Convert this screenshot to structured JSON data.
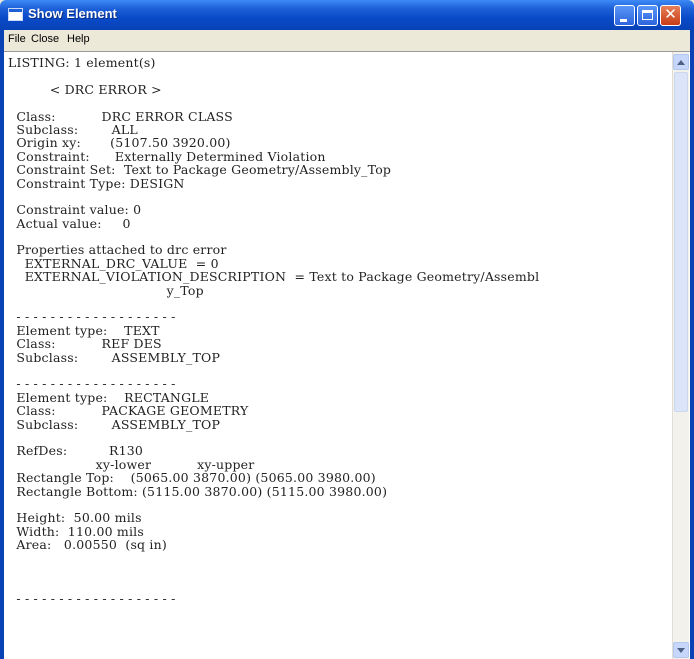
{
  "window": {
    "title": "Show Element",
    "buttons": {
      "close": "✕"
    }
  },
  "menu": {
    "file": "File",
    "close": "Close",
    "help": "Help"
  },
  "listing": [
    "LISTING: 1 element(s)",
    "",
    "          < DRC ERROR >",
    "",
    "  Class:           DRC ERROR CLASS",
    "  Subclass:        ALL",
    "  Origin xy:       (5107.50 3920.00)",
    "  Constraint:      Externally Determined Violation",
    "  Constraint Set:  Text to Package Geometry/Assembly_Top",
    "  Constraint Type: DESIGN",
    "",
    "  Constraint value: 0",
    "  Actual value:     0",
    "",
    "  Properties attached to drc error",
    "    EXTERNAL_DRC_VALUE  = 0",
    "    EXTERNAL_VIOLATION_DESCRIPTION  = Text to Package Geometry/Assembl",
    "                                      y_Top",
    "",
    "  - - - - - - - - - - - - - - - - - - -",
    "  Element type:    TEXT",
    "  Class:           REF DES",
    "  Subclass:        ASSEMBLY_TOP",
    "",
    "  - - - - - - - - - - - - - - - - - - -",
    "  Element type:    RECTANGLE",
    "  Class:           PACKAGE GEOMETRY",
    "  Subclass:        ASSEMBLY_TOP",
    "",
    "  RefDes:          R130",
    "                     xy-lower           xy-upper",
    "  Rectangle Top:    (5065.00 3870.00) (5065.00 3980.00)",
    "  Rectangle Bottom: (5115.00 3870.00) (5115.00 3980.00)",
    "",
    "  Height:  50.00 mils",
    "  Width:  110.00 mils",
    "  Area:   0.00550  (sq in)",
    "",
    "",
    "",
    "  - - - - - - - - - - - - - - - - - - -"
  ]
}
